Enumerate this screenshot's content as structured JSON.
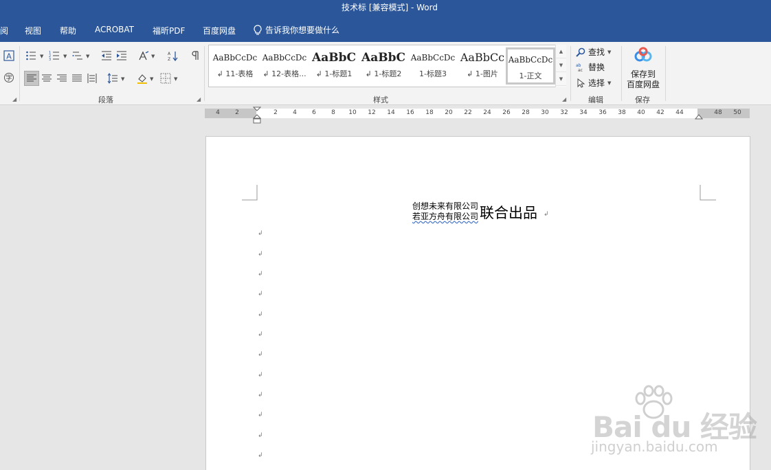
{
  "window": {
    "title": "技术标 [兼容模式]  -  Word"
  },
  "menu": {
    "tabs": [
      "阅",
      "视图",
      "帮助",
      "ACROBAT",
      "福昕PDF",
      "百度网盘"
    ],
    "tell_me": "告诉我你想要做什么"
  },
  "ribbon": {
    "paragraph_group": "段落",
    "styles_group": "样式",
    "editing_group": "编辑",
    "save_group": "保存",
    "styles": [
      {
        "preview": "AaBbCcDc",
        "name": "↲ 11-表格"
      },
      {
        "preview": "AaBbCcDc",
        "name": "↲ 12-表格..."
      },
      {
        "preview": "AaBbC",
        "name": "↲ 1-标题1"
      },
      {
        "preview": "AaBbC",
        "name": "↲ 1-标题2"
      },
      {
        "preview": "AaBbCcDc",
        "name": "1-标题3"
      },
      {
        "preview": "AaBbCc",
        "name": "↲ 1-图片"
      },
      {
        "preview": "AaBbCcDc",
        "name": "1-正文"
      }
    ],
    "find": "查找",
    "replace": "替换",
    "select": "选择",
    "save_to_line1": "保存到",
    "save_to_line2": "百度网盘"
  },
  "ruler": {
    "labels": [
      "4",
      "2",
      "2",
      "4",
      "6",
      "8",
      "10",
      "12",
      "14",
      "16",
      "18",
      "20",
      "22",
      "24",
      "26",
      "28",
      "30",
      "32",
      "34",
      "36",
      "38",
      "40",
      "42",
      "44",
      "48",
      "50"
    ]
  },
  "document": {
    "company_1": "创想未来有限公司",
    "company_2": "若亚方舟有限公司",
    "joint_text": "联合出品",
    "paragraph_mark": "↲"
  },
  "watermark": {
    "brand": "Bai  du 经验",
    "url": "jingyan.baidu.com"
  },
  "colors": {
    "word_blue": "#2b579a",
    "ribbon_bg": "#f3f3f3"
  }
}
